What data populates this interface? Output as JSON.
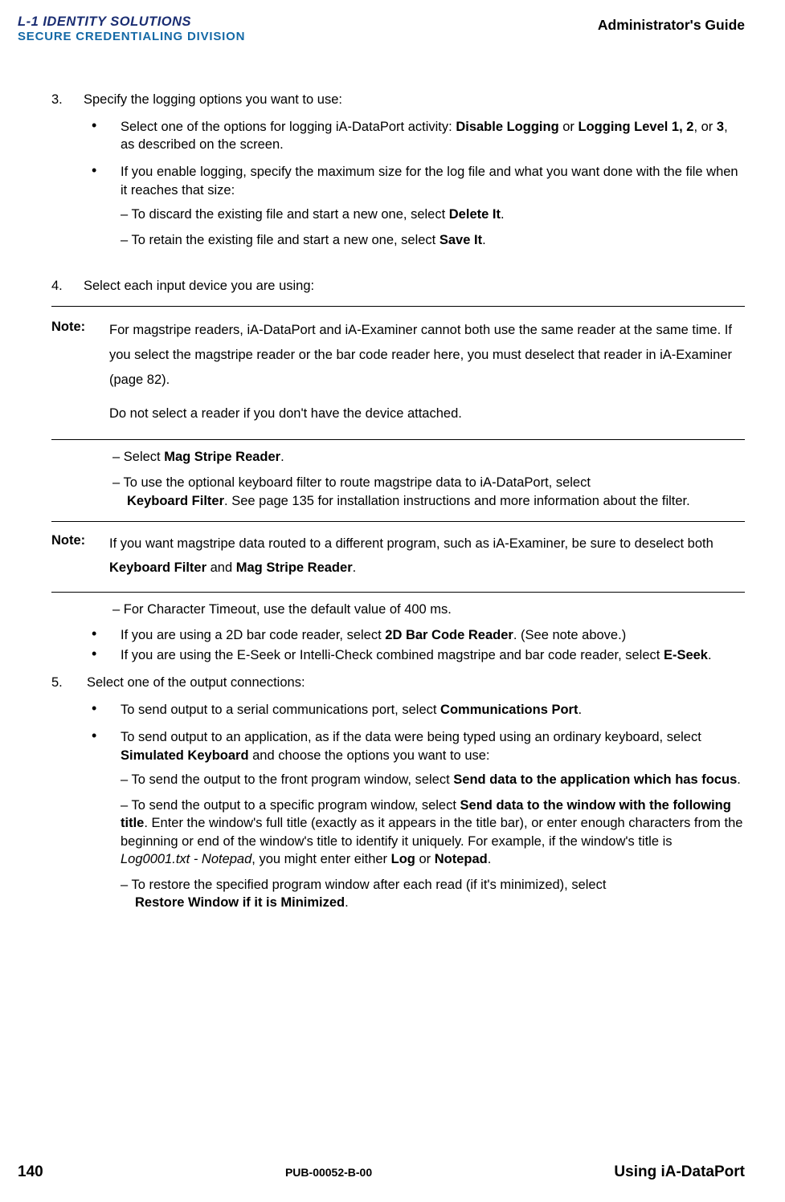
{
  "header": {
    "logo_line1_prefix": "L-1",
    "logo_line1_rest": " IDENTITY SOLUTIONS",
    "logo_line2": "SECURE CREDENTIALING DIVISION",
    "doc_title": "Administrator's Guide"
  },
  "steps": {
    "s3": "Specify the logging options you want to use:",
    "s3_b1_pre": "Select one of the options for logging iA-DataPort activity: ",
    "s3_b1_bold1": "Disable Logging",
    "s3_b1_mid": " or ",
    "s3_b1_bold2": "Logging Level 1, 2",
    "s3_b1_post": ", or ",
    "s3_b1_bold3": "3",
    "s3_b1_end": ", as described on the screen.",
    "s3_b2": "If you enable logging, specify the maximum  size for the log file and what you want done with the file when it reaches that size:",
    "s3_b2_d1_pre": "– To discard the existing file and start a new one, select ",
    "s3_b2_d1_bold": "Delete It",
    "s3_b2_d1_end": ".",
    "s3_b2_d2_pre": "– To retain the existing file and start a new one, select ",
    "s3_b2_d2_bold": "Save It",
    "s3_b2_d2_end": ".",
    "s4": "Select each input device you are using:",
    "note1_label": "Note:",
    "note1_p1": "For magstripe readers, iA-DataPort and iA-Examiner cannot both use the same reader at the same time. If you select the magstripe reader or the bar code reader here, you must deselect that reader in iA-Examiner (page 82).",
    "note1_p2": "Do not select a reader if you don't have the device attached.",
    "s4_d1_pre": "– Select ",
    "s4_d1_bold": "Mag Stripe Reader",
    "s4_d1_end": ".",
    "s4_d2_pre": "– To use the optional keyboard filter to route magstripe data to iA-DataPort, select",
    "s4_d2_bold": "Keyboard Filter",
    "s4_d2_rest": ". See page 135 for installation instructions and more information about the filter.",
    "note2_label": "Note:",
    "note2_pre": "If you want magstripe data routed to a different program, such as iA-Examiner, be sure to deselect both ",
    "note2_b1": "Keyboard Filter",
    "note2_mid": " and ",
    "note2_b2": "Mag Stripe Reader",
    "note2_end": ".",
    "s4_d3": "– For Character Timeout, use the default value of 400 ms.",
    "s4_b3_pre": "If you are using a 2D bar code reader, select ",
    "s4_b3_bold": "2D Bar Code Reader",
    "s4_b3_end": ". (See note above.)",
    "s4_b4_pre": "If you are using the E-Seek or Intelli-Check combined magstripe and bar code reader, select ",
    "s4_b4_bold": "E-Seek",
    "s4_b4_end": ".",
    "s5": "Select one of the output connections:",
    "s5_b1_pre": "To send output to a serial communications port, select ",
    "s5_b1_bold": "Communications Port",
    "s5_b1_end": ".",
    "s5_b2_pre": "To send output to an application, as if the data were being typed using an ordinary keyboard, select ",
    "s5_b2_bold": "Simulated Keyboard",
    "s5_b2_end": " and choose the options you want to use:",
    "s5_d1_pre": "– To send the output to the front program window, select ",
    "s5_d1_bold": "Send data to the application which has focus",
    "s5_d1_end": ".",
    "s5_d2_pre": "– To send the output to a specific program window, select ",
    "s5_d2_bold": "Send data to the window with the following title",
    "s5_d2_mid": ". Enter the window's full title (exactly as it appears in the title bar), or enter enough characters from the beginning or end of the window's title to identify it uniquely. For example, if the window's title is ",
    "s5_d2_ital": "Log0001.txt - Notepad",
    "s5_d2_mid2": ", you might enter either ",
    "s5_d2_bold2": "Log",
    "s5_d2_mid3": " or ",
    "s5_d2_bold3": "Notepad",
    "s5_d2_end": ".",
    "s5_d3_pre": "– To restore the specified program window after each read (if it's minimized), select",
    "s5_d3_bold": "Restore Window if it is Minimized",
    "s5_d3_end": "."
  },
  "footer": {
    "page": "140",
    "pub": "PUB-00052-B-00",
    "section": "Using iA-DataPort"
  }
}
